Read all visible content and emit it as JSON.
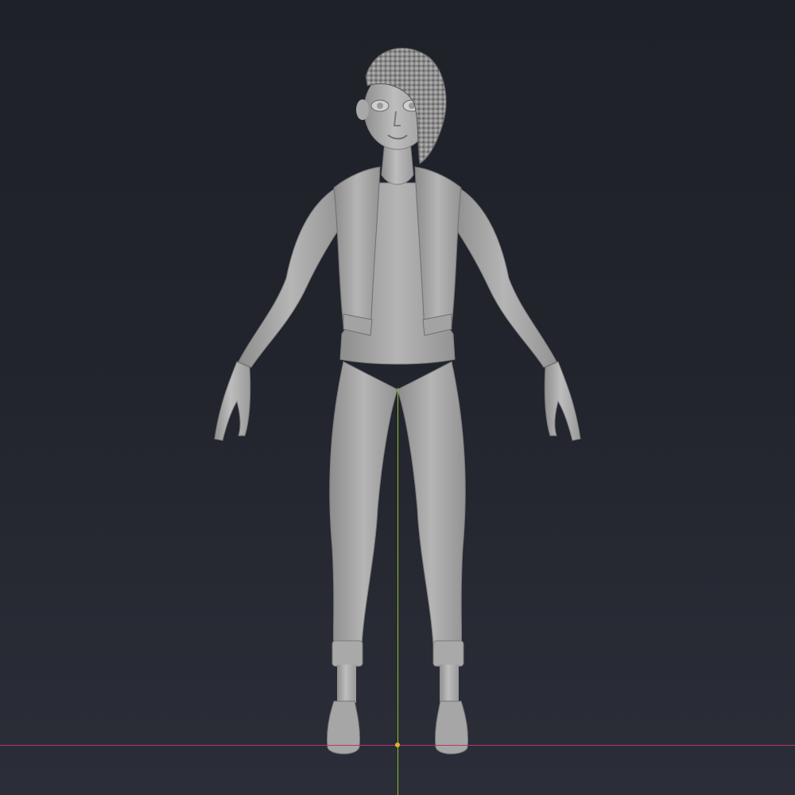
{
  "viewport": {
    "background_color": "#22242d",
    "x_axis_color": "#b8346a",
    "y_axis_color": "#8fbf22",
    "origin_color": "#e0b030"
  },
  "model": {
    "material_color": "#b7b7b7",
    "pose": "A-pose",
    "parts": [
      "hair",
      "head",
      "neck",
      "jacket",
      "top",
      "arms",
      "hands",
      "leggings",
      "sneakers"
    ]
  }
}
